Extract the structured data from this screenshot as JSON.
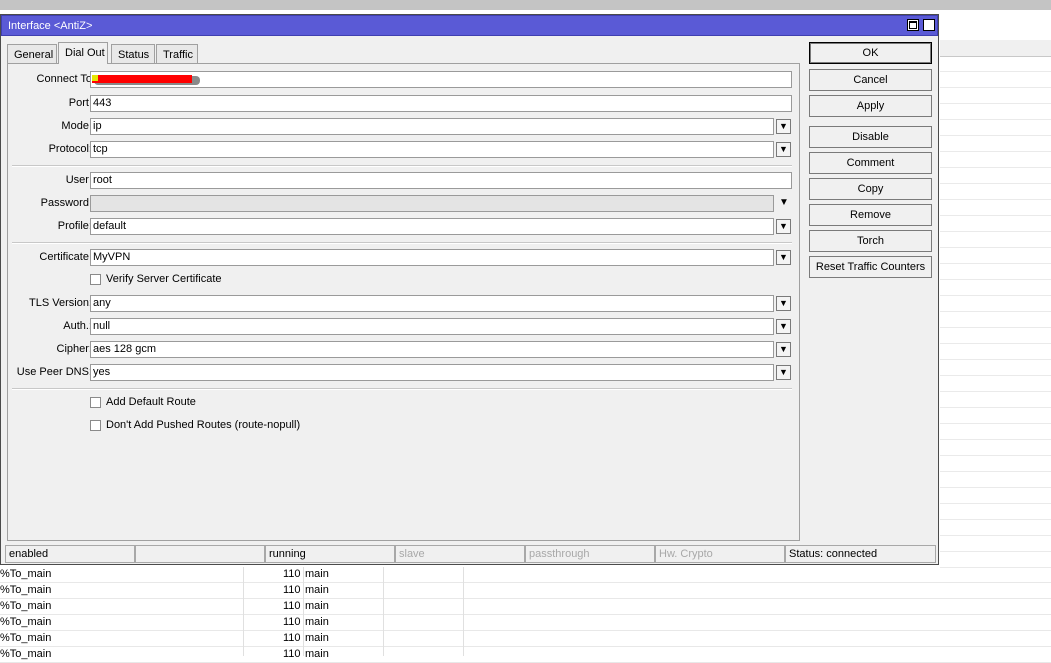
{
  "window": {
    "title": "Interface <AntiZ>"
  },
  "tabs": [
    {
      "label": "General"
    },
    {
      "label": "Dial Out"
    },
    {
      "label": "Status"
    },
    {
      "label": "Traffic"
    }
  ],
  "form": {
    "connect_to": {
      "label": "Connect To",
      "value": ""
    },
    "port": {
      "label": "Port:",
      "value": "443"
    },
    "mode": {
      "label": "Mode:",
      "value": "ip"
    },
    "protocol": {
      "label": "Protocol:",
      "value": "tcp"
    },
    "user": {
      "label": "User:",
      "value": "root"
    },
    "password": {
      "label": "Password:",
      "value": ""
    },
    "profile": {
      "label": "Profile:",
      "value": "default"
    },
    "certificate": {
      "label": "Certificate:",
      "value": "MyVPN"
    },
    "verify_server_certificate": {
      "label": "Verify Server Certificate",
      "checked": false
    },
    "tls_version": {
      "label": "TLS Version:",
      "value": "any"
    },
    "auth": {
      "label": "Auth.:",
      "value": "null"
    },
    "cipher": {
      "label": "Cipher:",
      "value": "aes 128 gcm"
    },
    "use_peer_dns": {
      "label": "Use Peer DNS:",
      "value": "yes"
    },
    "add_default_route": {
      "label": "Add Default Route",
      "checked": false
    },
    "dont_add_pushed_routes": {
      "label": "Don't Add Pushed Routes (route-nopull)",
      "checked": false
    }
  },
  "buttons": {
    "ok": "OK",
    "cancel": "Cancel",
    "apply": "Apply",
    "disable": "Disable",
    "comment": "Comment",
    "copy": "Copy",
    "remove": "Remove",
    "torch": "Torch",
    "reset_traffic_counters": "Reset Traffic Counters"
  },
  "statusbar": {
    "state": "enabled",
    "empty": "",
    "running": "running",
    "slave": "slave",
    "passthrough": "passthrough",
    "hw_crypto": "Hw. Crypto",
    "status": "Status: connected"
  },
  "background_rows": [
    {
      "name": "%To_main",
      "distance": "110",
      "table": "main"
    },
    {
      "name": "%To_main",
      "distance": "110",
      "table": "main"
    },
    {
      "name": "%To_main",
      "distance": "110",
      "table": "main"
    },
    {
      "name": "%To_main",
      "distance": "110",
      "table": "main"
    },
    {
      "name": "%To_main",
      "distance": "110",
      "table": "main"
    },
    {
      "name": "%To_main",
      "distance": "110",
      "table": "main"
    }
  ],
  "colors": {
    "titlebar": "#5a5ad6",
    "redaction": "#ff0000"
  },
  "icons": {
    "maximize": "maximize-icon",
    "close": "close-icon",
    "dropdown": "dropdown-arrow-icon"
  }
}
